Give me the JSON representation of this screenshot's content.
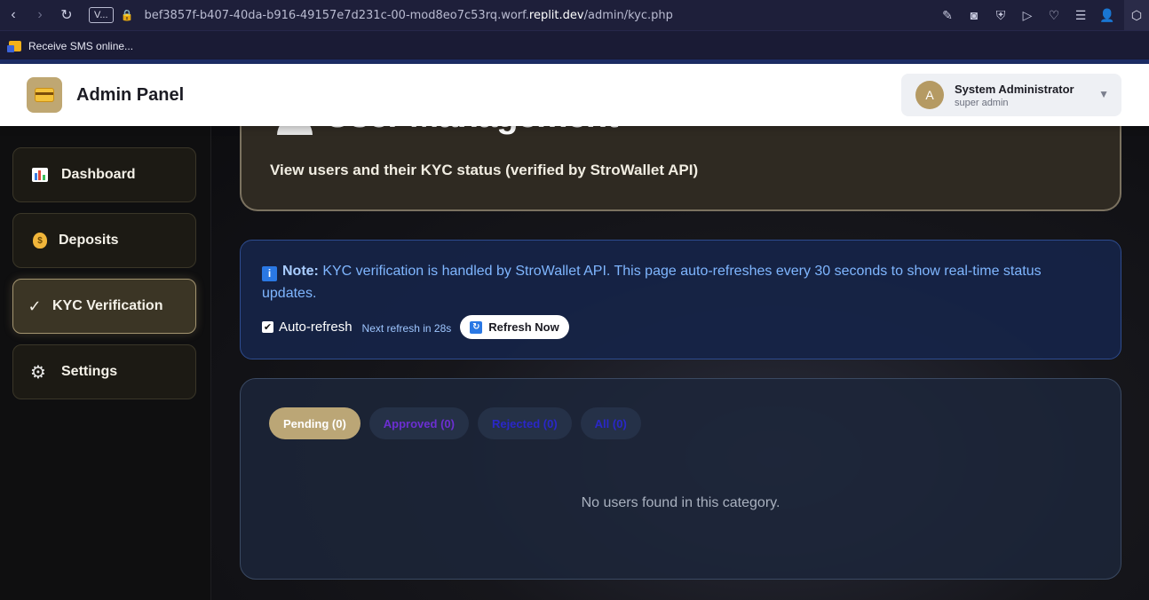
{
  "browser": {
    "tab_chip": "V...",
    "url_prefix": "bef3857f-b407-40da-b916-49157e7d231c-00-mod8eo7c53rq.worf.",
    "url_host": "replit.dev",
    "url_path": "/admin/kyc.php",
    "bookmark": "Receive SMS online..."
  },
  "header": {
    "title": "Admin Panel",
    "user_initial": "A",
    "user_name": "System Administrator",
    "user_role": "super admin"
  },
  "sidebar": {
    "items": [
      {
        "label": "Dashboard",
        "icon": "bar-chart-icon"
      },
      {
        "label": "Deposits",
        "icon": "money-bag-icon"
      },
      {
        "label": "KYC Verification",
        "icon": "check-icon",
        "glyph": "✓"
      },
      {
        "label": "Settings",
        "icon": "gear-icon",
        "glyph": "⚙"
      }
    ],
    "active_index": 2
  },
  "hero": {
    "title": "User Management",
    "subtitle": "View users and their KYC status (verified by StroWallet API)"
  },
  "note": {
    "icon_glyph": "i",
    "strong": "Note:",
    "text": " KYC verification is handled by StroWallet API. This page auto-refreshes every 30 seconds to show real-time status updates.",
    "auto_refresh_label": "Auto-refresh",
    "auto_refresh_checked": true,
    "next_refresh": "Next refresh in 28s",
    "refresh_button": "Refresh Now"
  },
  "tabs": [
    {
      "label": "Pending (0)",
      "active": true
    },
    {
      "label": "Approved (0)",
      "active": false
    },
    {
      "label": "Rejected (0)",
      "active": false
    },
    {
      "label": "All (0)",
      "active": false
    }
  ],
  "empty_message": "No users found in this category.",
  "colors": {
    "accent": "#bba676",
    "note_bg": "#162448",
    "note_text": "#7fb6ff"
  }
}
